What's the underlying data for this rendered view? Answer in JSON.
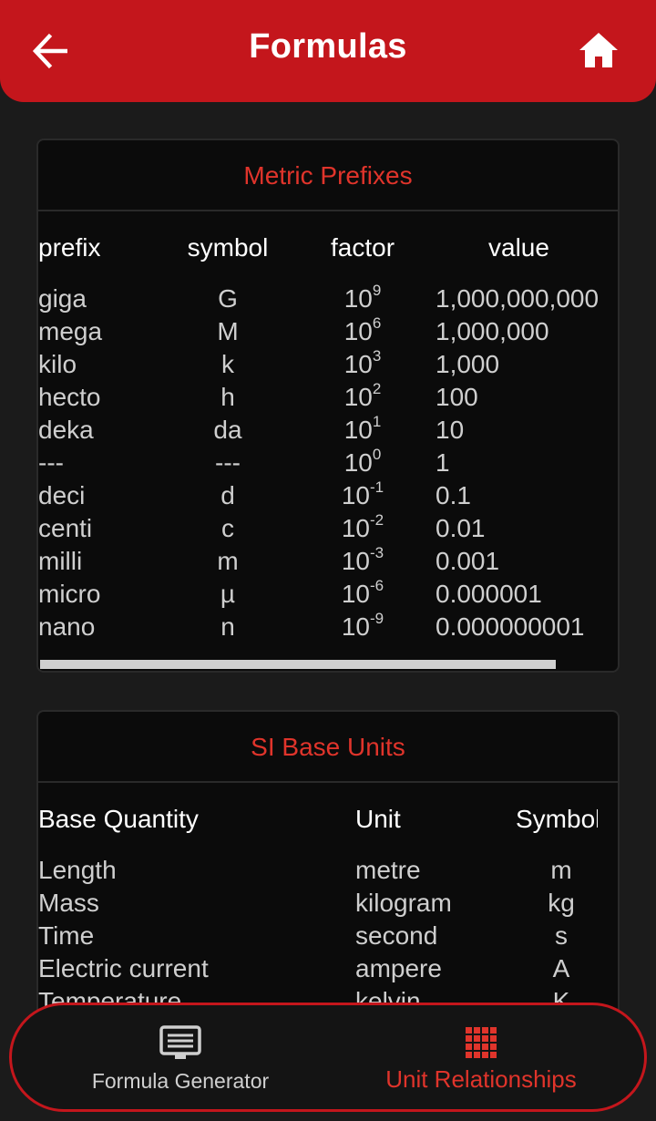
{
  "header": {
    "title": "Formulas",
    "back_icon": "arrow-left-icon",
    "home_icon": "home-icon"
  },
  "metric_prefixes": {
    "title": "Metric Prefixes",
    "columns": [
      "prefix",
      "symbol",
      "factor",
      "value"
    ],
    "rows": [
      {
        "prefix": "giga",
        "symbol": "G",
        "factor_base": "10",
        "factor_exp": "9",
        "value": "1,000,000,000"
      },
      {
        "prefix": "mega",
        "symbol": "M",
        "factor_base": "10",
        "factor_exp": "6",
        "value": "1,000,000"
      },
      {
        "prefix": "kilo",
        "symbol": "k",
        "factor_base": "10",
        "factor_exp": "3",
        "value": "1,000"
      },
      {
        "prefix": "hecto",
        "symbol": "h",
        "factor_base": "10",
        "factor_exp": "2",
        "value": "100"
      },
      {
        "prefix": "deka",
        "symbol": "da",
        "factor_base": "10",
        "factor_exp": "1",
        "value": "10"
      },
      {
        "prefix": "---",
        "symbol": "---",
        "factor_base": "10",
        "factor_exp": "0",
        "value": "1"
      },
      {
        "prefix": "deci",
        "symbol": "d",
        "factor_base": "10",
        "factor_exp": "-1",
        "value": "0.1"
      },
      {
        "prefix": "centi",
        "symbol": "c",
        "factor_base": "10",
        "factor_exp": "-2",
        "value": "0.01"
      },
      {
        "prefix": "milli",
        "symbol": "m",
        "factor_base": "10",
        "factor_exp": "-3",
        "value": "0.001"
      },
      {
        "prefix": "micro",
        "symbol": "µ",
        "factor_base": "10",
        "factor_exp": "-6",
        "value": "0.000001"
      },
      {
        "prefix": "nano",
        "symbol": "n",
        "factor_base": "10",
        "factor_exp": "-9",
        "value": "0.000000001"
      }
    ]
  },
  "si_base_units": {
    "title": "SI Base Units",
    "columns": [
      "Base Quantity",
      "Unit",
      "Symbol"
    ],
    "rows": [
      {
        "quantity": "Length",
        "unit": "metre",
        "symbol": "m"
      },
      {
        "quantity": "Mass",
        "unit": "kilogram",
        "symbol": "kg"
      },
      {
        "quantity": "Time",
        "unit": "second",
        "symbol": "s"
      },
      {
        "quantity": "Electric current",
        "unit": "ampere",
        "symbol": "A"
      },
      {
        "quantity": "Temperature",
        "unit": "kelvin",
        "symbol": "K"
      }
    ]
  },
  "bottom_nav": {
    "items": [
      {
        "label": "Formula Generator",
        "icon": "formula-generator-icon",
        "active": false
      },
      {
        "label": "Unit Relationships",
        "icon": "grid-icon",
        "active": true
      }
    ]
  },
  "colors": {
    "accent": "#c4161c",
    "accent_text": "#e0342b",
    "background": "#1b1b1b",
    "card": "#0b0b0b"
  }
}
